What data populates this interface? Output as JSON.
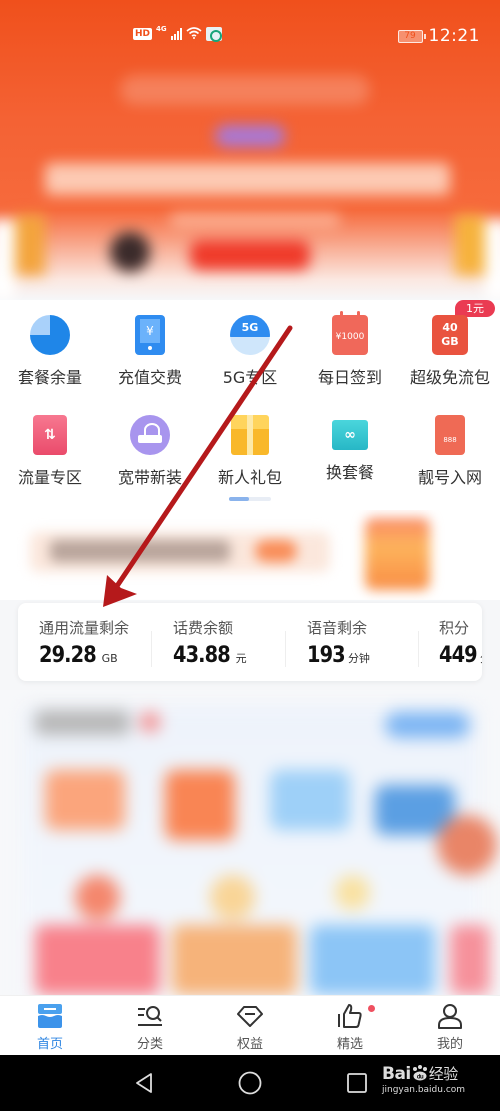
{
  "status_bar": {
    "left_icons": [
      "hd-icon",
      "4g-icon",
      "signal-icon",
      "wifi-icon",
      "app-notification-icon"
    ],
    "hd_label": "HD",
    "network_label": "4G",
    "battery_level": "79",
    "time": "12:21"
  },
  "quick_menu": {
    "items": [
      {
        "label": "套餐余量",
        "icon": "pie-chart-icon"
      },
      {
        "label": "充值交费",
        "icon": "phone-payment-icon",
        "glyph": "¥"
      },
      {
        "label": "5G专区",
        "icon": "5g-icon",
        "glyph": "5G"
      },
      {
        "label": "每日签到",
        "icon": "calendar-icon",
        "glyph": "¥1000"
      },
      {
        "label": "超级免流包",
        "icon": "data-ticket-icon",
        "glyph": "40\nGB",
        "badge": "1元"
      },
      {
        "label": "流量专区",
        "icon": "data-transfer-icon",
        "glyph": "⇅"
      },
      {
        "label": "宽带新装",
        "icon": "router-icon"
      },
      {
        "label": "新人礼包",
        "icon": "gift-icon"
      },
      {
        "label": "换套餐",
        "icon": "folder-icon",
        "glyph": "∞"
      },
      {
        "label": "靓号入网",
        "icon": "phone-number-icon",
        "glyph": "888"
      }
    ],
    "page_indicator": {
      "current": 1,
      "total": 2
    }
  },
  "balance": {
    "items": [
      {
        "label": "通用流量剩余",
        "value": "29.28",
        "unit": "GB"
      },
      {
        "label": "话费余额",
        "value": "43.88",
        "unit": "元"
      },
      {
        "label": "语音剩余",
        "value": "193",
        "unit": "分钟"
      },
      {
        "label": "积分",
        "value": "449",
        "unit": "分"
      }
    ]
  },
  "tab_bar": {
    "tabs": [
      {
        "label": "首页",
        "icon": "home-icon",
        "active": true
      },
      {
        "label": "分类",
        "icon": "category-search-icon",
        "active": false
      },
      {
        "label": "权益",
        "icon": "diamond-icon",
        "active": false
      },
      {
        "label": "精选",
        "icon": "thumbs-up-icon",
        "active": false,
        "notification_dot": true
      },
      {
        "label": "我的",
        "icon": "profile-icon",
        "active": false
      }
    ]
  },
  "nav_bar": {
    "buttons": [
      "back-icon",
      "home-circle-icon",
      "recents-icon"
    ]
  },
  "watermark": {
    "brand": "Bai",
    "brand_suffix": "经验",
    "url": "jingyan.baidu.com"
  },
  "colors": {
    "brand_orange": "#f0501c",
    "active_tab_blue": "#2f86e2",
    "annotation_arrow": "#b5191b",
    "badge_red": "#ea3b52"
  }
}
